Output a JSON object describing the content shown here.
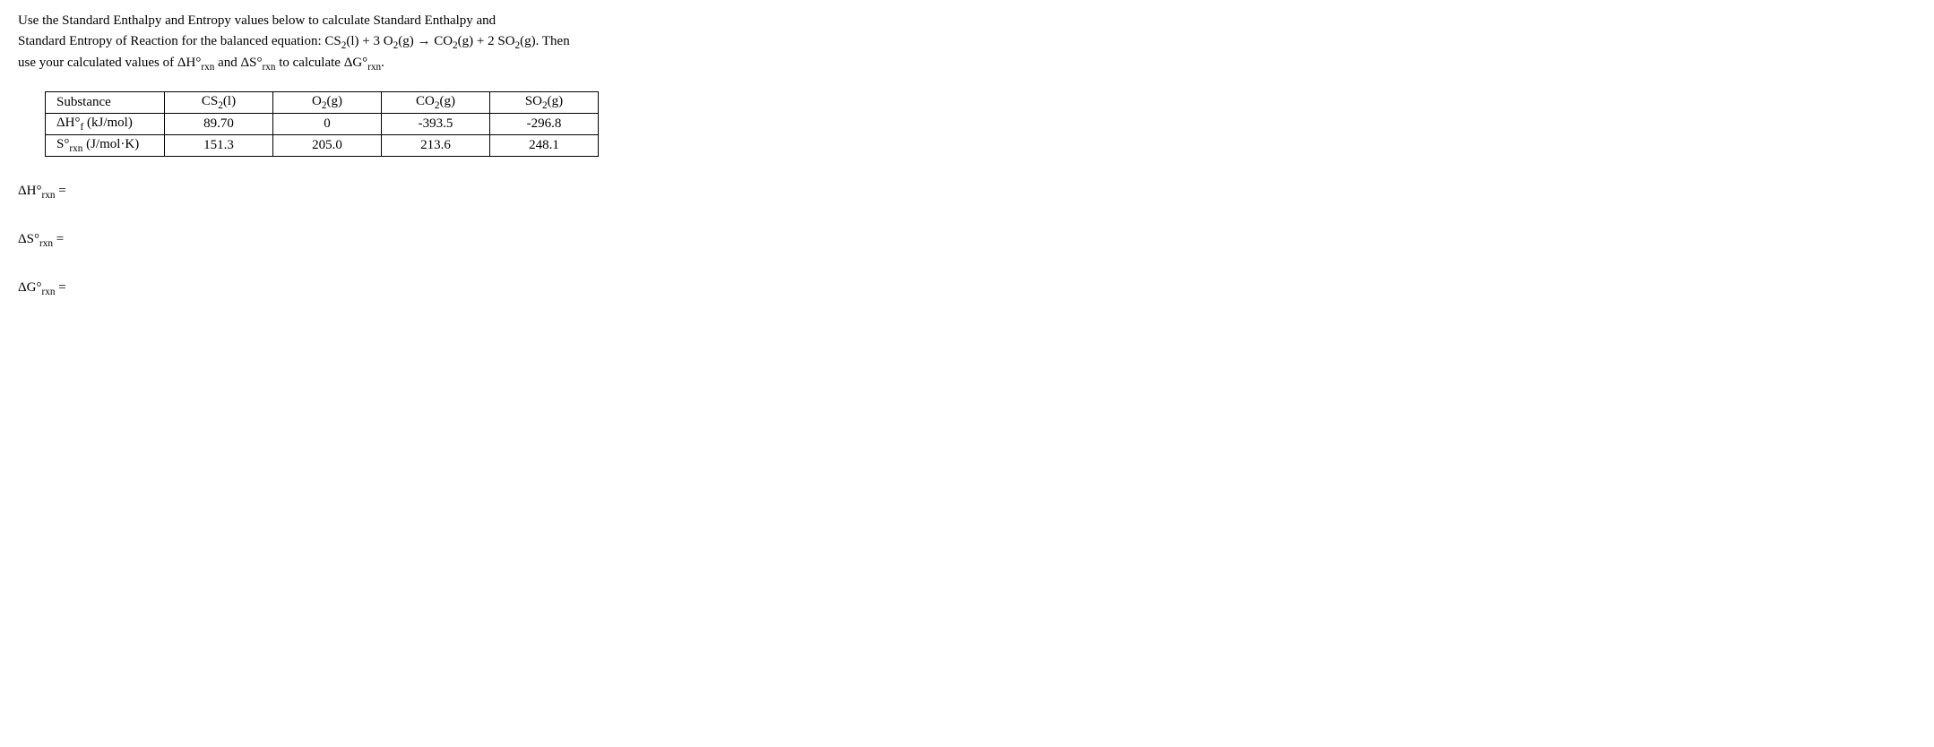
{
  "question": {
    "line1_pre": "Use the Standard Enthalpy and Entropy values below to calculate Standard Enthalpy and",
    "line2_pre": "Standard Entropy of Reaction for the balanced equation: ",
    "eq_cs2": "CS",
    "eq_cs2_sub": "2",
    "eq_cs2_state": "(l) + 3 O",
    "eq_o2_sub": "2",
    "eq_o2_state": "(g) → CO",
    "eq_co2_sub": "2",
    "eq_co2_state": "(g) + 2 SO",
    "eq_so2_sub": "2",
    "eq_so2_state": "(g).  Then",
    "line3_pre": "use your calculated values of ΔH°",
    "line3_sub1": "rxn",
    "line3_mid": " and ΔS°",
    "line3_sub2": "rxn",
    "line3_mid2": " to calculate ΔG°",
    "line3_sub3": "rxn",
    "line3_end": "."
  },
  "table": {
    "headers": {
      "substance": "Substance",
      "cs2": "CS",
      "cs2_sub": "2",
      "cs2_state": "(l)",
      "o2": "O",
      "o2_sub": "2",
      "o2_state": "(g)",
      "co2": "CO",
      "co2_sub": "2",
      "co2_state": "(g)",
      "so2": "SO",
      "so2_sub": "2",
      "so2_state": "(g)"
    },
    "row1": {
      "label_pre": "ΔH°",
      "label_sub": "f",
      "label_unit": " (kJ/mol)",
      "cs2": "89.70",
      "o2": "0",
      "co2": "-393.5",
      "so2": "-296.8"
    },
    "row2": {
      "label_pre": "S°",
      "label_sub": "rxn",
      "label_unit": " (J/mol·K)",
      "cs2": "151.3",
      "o2": "205.0",
      "co2": "213.6",
      "so2": "248.1"
    }
  },
  "answers": {
    "dh_pre": "ΔH°",
    "dh_sub": "rxn",
    "dh_eq": " =",
    "ds_pre": "ΔS°",
    "ds_sub": "rxn",
    "ds_eq": " =",
    "dg_pre": "ΔG°",
    "dg_sub": "rxn",
    "dg_eq": " ="
  }
}
